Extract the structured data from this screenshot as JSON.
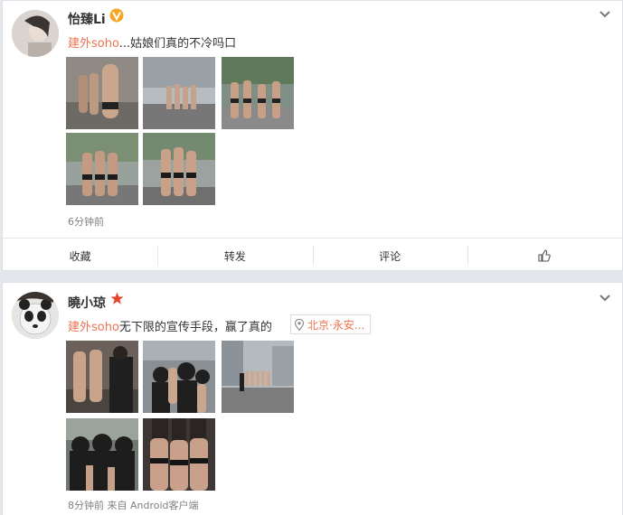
{
  "posts": [
    {
      "author": "怡臻Li",
      "badge": "V",
      "text_keyword": "建外soho",
      "text_rest": "...姑娘们真的不冷吗口",
      "time": "6分钟前",
      "actions": {
        "favorite": "收藏",
        "repost": "转发",
        "comment": "评论"
      },
      "icons": {
        "verified": "verified-badge-icon",
        "more": "chevron-down-icon",
        "like": "thumbs-up-icon"
      }
    },
    {
      "author": "曉小琼",
      "badge": "★",
      "text_keyword": "建外soho",
      "text_rest": "无下限的宣传手段，赢了真的",
      "location": "北京·永安...",
      "meta": "8分钟前 来自 Android客户端",
      "icons": {
        "star": "star-badge-icon",
        "more": "chevron-down-icon",
        "location": "location-pin-icon"
      }
    }
  ],
  "colors": {
    "keyword": "#eb7350",
    "verified": "#f5a623",
    "star": "#e8452c",
    "meta": "#808080"
  }
}
